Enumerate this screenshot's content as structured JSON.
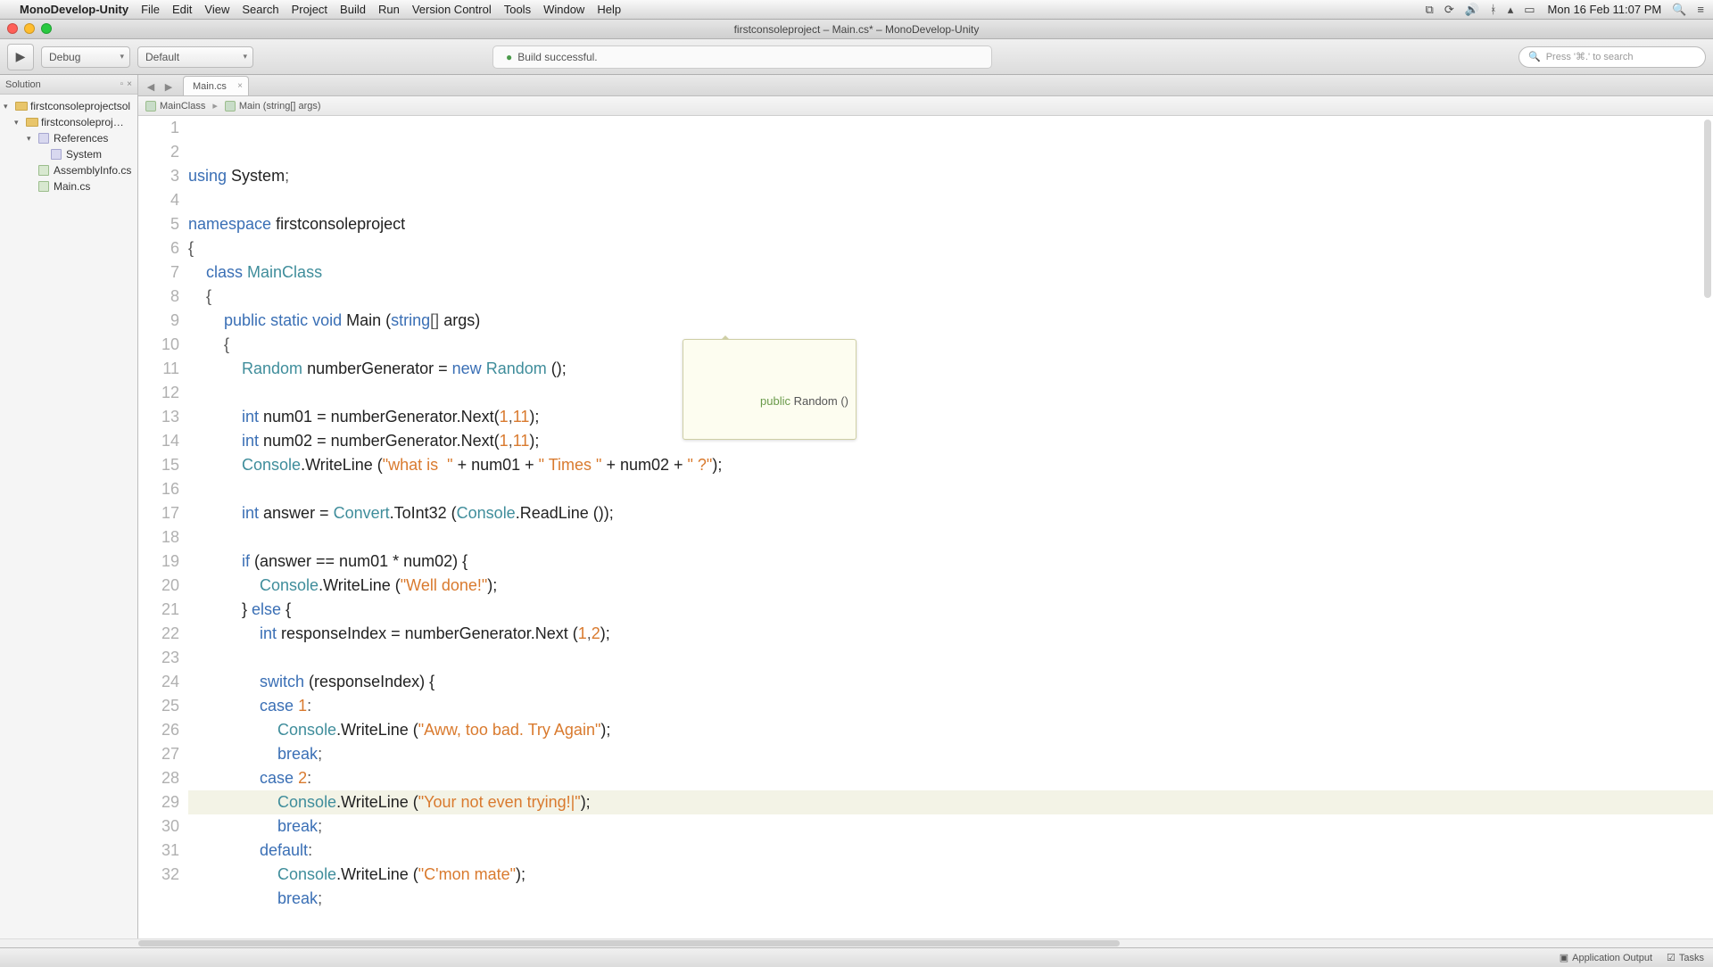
{
  "menubar": {
    "app_name": "MonoDevelop-Unity",
    "items": [
      "File",
      "Edit",
      "View",
      "Search",
      "Project",
      "Build",
      "Run",
      "Version Control",
      "Tools",
      "Window",
      "Help"
    ],
    "clock": "Mon 16 Feb  11:07 PM"
  },
  "titlebar": {
    "title": "firstconsoleproject – Main.cs* – MonoDevelop-Unity"
  },
  "toolbar": {
    "config": "Debug",
    "target": "Default",
    "build_status": "Build successful.",
    "search_placeholder": "Press '⌘.' to search"
  },
  "pad": {
    "title": "Solution",
    "tree": {
      "root": "firstconsoleprojectsol",
      "project": "firstconsoleproj…",
      "refs": "References",
      "system": "System",
      "asm": "AssemblyInfo.cs",
      "main": "Main.cs"
    }
  },
  "tabs": {
    "active": "Main.cs"
  },
  "breadcrumb": {
    "class": "MainClass",
    "method": "Main (string[] args)"
  },
  "tooltip": {
    "sig_kw": "public",
    "sig_rest": " Random ()"
  },
  "statusbar": {
    "output": "Application Output",
    "tasks": "Tasks"
  },
  "code": {
    "highlight_line": 27,
    "lines": [
      {
        "n": 1,
        "tokens": [
          [
            "kw",
            "using"
          ],
          [
            "",
            " "
          ],
          [
            "ident",
            "System"
          ],
          [
            "op",
            ";"
          ]
        ]
      },
      {
        "n": 2,
        "tokens": []
      },
      {
        "n": 3,
        "tokens": [
          [
            "kw",
            "namespace"
          ],
          [
            "",
            " "
          ],
          [
            "ident",
            "firstconsoleproject"
          ]
        ]
      },
      {
        "n": 4,
        "tokens": [
          [
            "op",
            "{"
          ]
        ]
      },
      {
        "n": 5,
        "tokens": [
          [
            "",
            "    "
          ],
          [
            "kw",
            "class"
          ],
          [
            "",
            " "
          ],
          [
            "type",
            "MainClass"
          ]
        ]
      },
      {
        "n": 6,
        "tokens": [
          [
            "",
            "    "
          ],
          [
            "op",
            "{"
          ]
        ]
      },
      {
        "n": 7,
        "tokens": [
          [
            "",
            "        "
          ],
          [
            "kw",
            "public"
          ],
          [
            "",
            " "
          ],
          [
            "kw",
            "static"
          ],
          [
            "",
            " "
          ],
          [
            "kw",
            "void"
          ],
          [
            "",
            " "
          ],
          [
            "ident",
            "Main ("
          ],
          [
            "kw",
            "string"
          ],
          [
            "op",
            "[]"
          ],
          [
            "",
            " "
          ],
          [
            "ident",
            "args)"
          ]
        ]
      },
      {
        "n": 8,
        "tokens": [
          [
            "",
            "        "
          ],
          [
            "op",
            "{"
          ]
        ]
      },
      {
        "n": 9,
        "tokens": [
          [
            "",
            "            "
          ],
          [
            "type",
            "Random"
          ],
          [
            "",
            " numberGenerator = "
          ],
          [
            "kw",
            "new"
          ],
          [
            "",
            " "
          ],
          [
            "type",
            "Random"
          ],
          [
            "",
            " ();"
          ]
        ]
      },
      {
        "n": 10,
        "tokens": []
      },
      {
        "n": 11,
        "tokens": [
          [
            "",
            "            "
          ],
          [
            "kw",
            "int"
          ],
          [
            "",
            " num01 = numberGenerator.Next("
          ],
          [
            "num",
            "1"
          ],
          [
            "op",
            ","
          ],
          [
            "num",
            "11"
          ],
          [
            "",
            ");"
          ]
        ]
      },
      {
        "n": 12,
        "tokens": [
          [
            "",
            "            "
          ],
          [
            "kw",
            "int"
          ],
          [
            "",
            " num02 = numberGenerator.Next("
          ],
          [
            "num",
            "1"
          ],
          [
            "op",
            ","
          ],
          [
            "num",
            "11"
          ],
          [
            "",
            ");"
          ]
        ]
      },
      {
        "n": 13,
        "tokens": [
          [
            "",
            "            "
          ],
          [
            "type",
            "Console"
          ],
          [
            "",
            ".WriteLine ("
          ],
          [
            "str",
            "\"what is  \""
          ],
          [
            "",
            " + num01 + "
          ],
          [
            "str",
            "\" Times \""
          ],
          [
            "",
            " + num02 + "
          ],
          [
            "str",
            "\" ?\""
          ],
          [
            "",
            ");"
          ]
        ]
      },
      {
        "n": 14,
        "tokens": []
      },
      {
        "n": 15,
        "tokens": [
          [
            "",
            "            "
          ],
          [
            "kw",
            "int"
          ],
          [
            "",
            " answer = "
          ],
          [
            "type",
            "Convert"
          ],
          [
            "",
            ".ToInt32 ("
          ],
          [
            "type",
            "Console"
          ],
          [
            "",
            ".ReadLine ());"
          ]
        ]
      },
      {
        "n": 16,
        "tokens": []
      },
      {
        "n": 17,
        "tokens": [
          [
            "",
            "            "
          ],
          [
            "kw",
            "if"
          ],
          [
            "",
            " (answer == num01 * num02) {"
          ]
        ]
      },
      {
        "n": 18,
        "tokens": [
          [
            "",
            "                "
          ],
          [
            "type",
            "Console"
          ],
          [
            "",
            ".WriteLine ("
          ],
          [
            "str",
            "\"Well done!\""
          ],
          [
            "",
            ");"
          ]
        ]
      },
      {
        "n": 19,
        "tokens": [
          [
            "",
            "            } "
          ],
          [
            "kw",
            "else"
          ],
          [
            "",
            " {"
          ]
        ]
      },
      {
        "n": 20,
        "tokens": [
          [
            "",
            "                "
          ],
          [
            "kw",
            "int"
          ],
          [
            "",
            " responseIndex = numberGenerator.Next ("
          ],
          [
            "num",
            "1"
          ],
          [
            "op",
            ","
          ],
          [
            "num",
            "2"
          ],
          [
            "",
            ");"
          ]
        ]
      },
      {
        "n": 21,
        "tokens": []
      },
      {
        "n": 22,
        "tokens": [
          [
            "",
            "                "
          ],
          [
            "kw",
            "switch"
          ],
          [
            "",
            " (responseIndex) {"
          ]
        ]
      },
      {
        "n": 23,
        "tokens": [
          [
            "",
            "                "
          ],
          [
            "kw",
            "case"
          ],
          [
            "",
            " "
          ],
          [
            "num",
            "1"
          ],
          [
            "op",
            ":"
          ]
        ]
      },
      {
        "n": 24,
        "tokens": [
          [
            "",
            "                    "
          ],
          [
            "type",
            "Console"
          ],
          [
            "",
            ".WriteLine ("
          ],
          [
            "str",
            "\"Aww, too bad. Try Again\""
          ],
          [
            "",
            ");"
          ]
        ]
      },
      {
        "n": 25,
        "tokens": [
          [
            "",
            "                    "
          ],
          [
            "kw",
            "break"
          ],
          [
            "op",
            ";"
          ]
        ]
      },
      {
        "n": 26,
        "tokens": [
          [
            "",
            "                "
          ],
          [
            "kw",
            "case"
          ],
          [
            "",
            " "
          ],
          [
            "num",
            "2"
          ],
          [
            "op",
            ":"
          ]
        ]
      },
      {
        "n": 27,
        "tokens": [
          [
            "",
            "                    "
          ],
          [
            "type",
            "Console"
          ],
          [
            "",
            ".WriteLine ("
          ],
          [
            "str",
            "\"Your not even trying!|\""
          ],
          [
            "",
            ");"
          ]
        ]
      },
      {
        "n": 28,
        "tokens": [
          [
            "",
            "                    "
          ],
          [
            "kw",
            "break"
          ],
          [
            "op",
            ";"
          ]
        ]
      },
      {
        "n": 29,
        "tokens": [
          [
            "",
            "                "
          ],
          [
            "kw",
            "default"
          ],
          [
            "op",
            ":"
          ]
        ]
      },
      {
        "n": 30,
        "tokens": [
          [
            "",
            "                    "
          ],
          [
            "type",
            "Console"
          ],
          [
            "",
            ".WriteLine ("
          ],
          [
            "str",
            "\"C'mon mate\""
          ],
          [
            "",
            ");"
          ]
        ]
      },
      {
        "n": 31,
        "tokens": [
          [
            "",
            "                    "
          ],
          [
            "kw",
            "break"
          ],
          [
            "op",
            ";"
          ]
        ]
      },
      {
        "n": 32,
        "tokens": []
      }
    ]
  }
}
